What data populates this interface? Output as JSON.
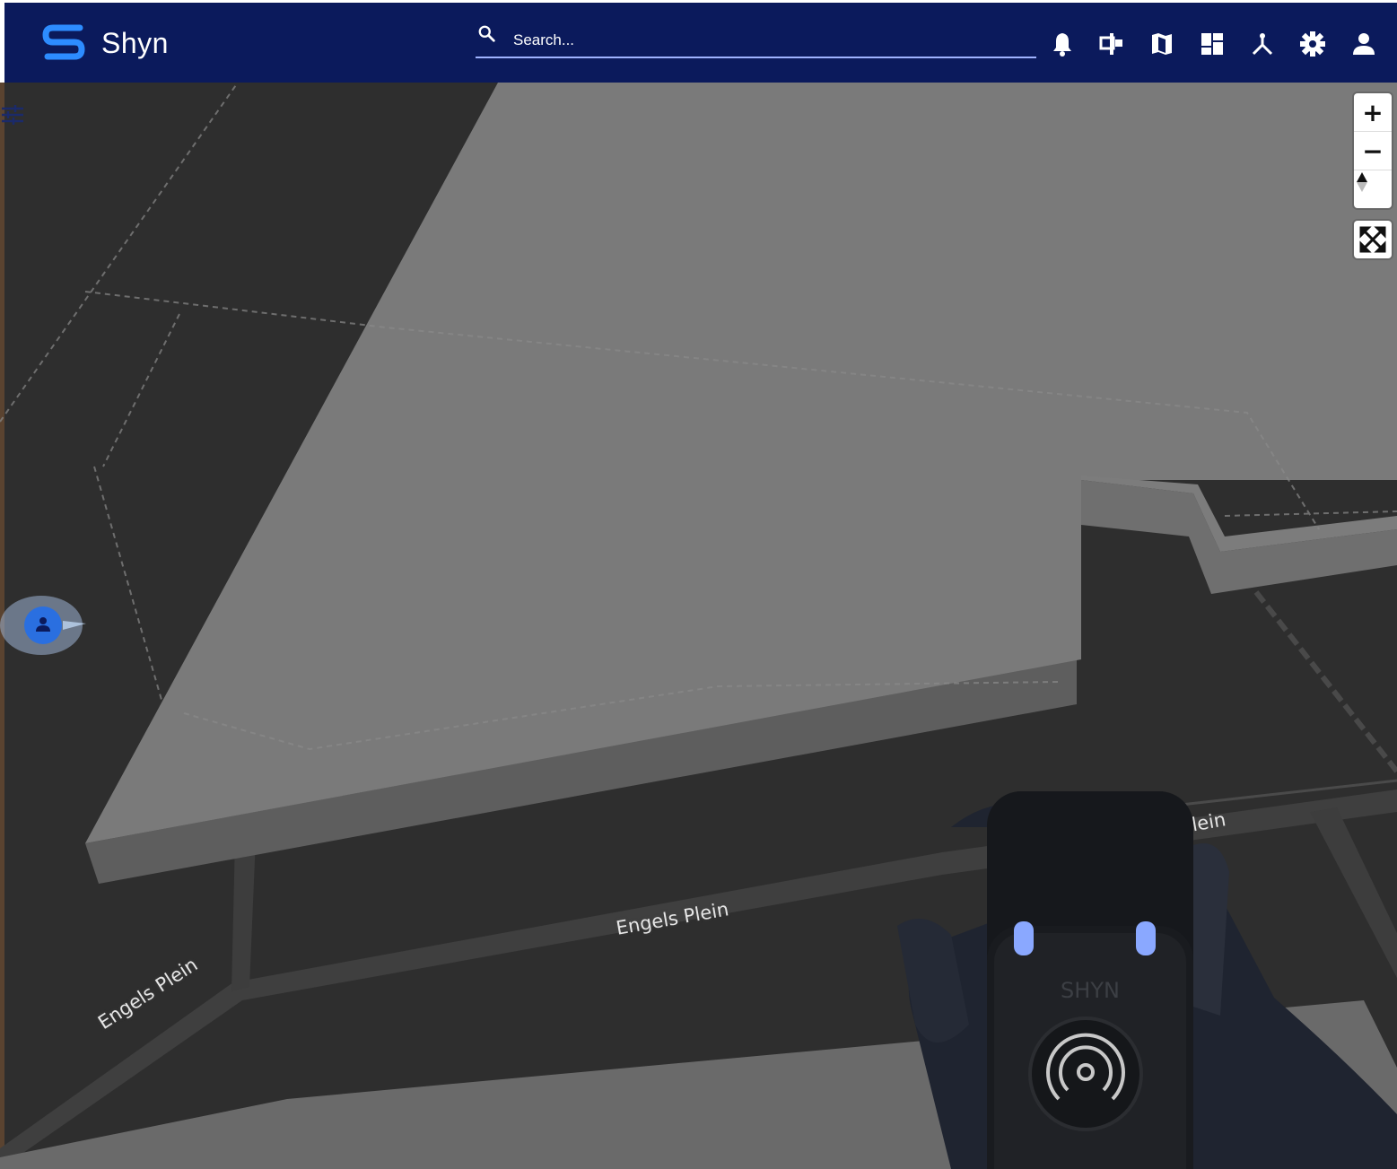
{
  "app": {
    "name": "Shyn"
  },
  "search": {
    "placeholder": "Search..."
  },
  "toolbar": {
    "icons": [
      "bell-icon",
      "devices-icon",
      "map-icon",
      "dashboard-icon",
      "hub-icon",
      "gear-icon",
      "user-icon"
    ]
  },
  "map": {
    "controls": {
      "zoom_in": "+",
      "zoom_out": "−"
    },
    "streets": [
      "Engels Plein",
      "Engels Plein",
      "Engels Plein"
    ]
  },
  "device": {
    "brand": "SHYN"
  },
  "colors": {
    "header": "#0b1a5c",
    "accent": "#1e6bff",
    "marker": "#2a6fe0"
  }
}
